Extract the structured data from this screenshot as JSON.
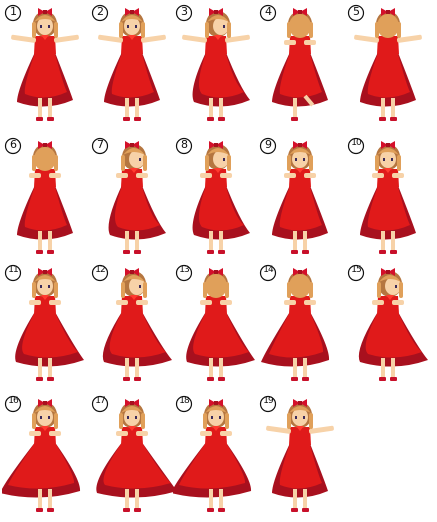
{
  "sheet": {
    "frames": [
      {
        "label": "1",
        "pose": "front-arms-out"
      },
      {
        "label": "2",
        "pose": "three-quarter-arms-out"
      },
      {
        "label": "3",
        "pose": "side-arms-out"
      },
      {
        "label": "4",
        "pose": "back-side-kick"
      },
      {
        "label": "5",
        "pose": "back-arms-out"
      },
      {
        "label": "6",
        "pose": "back-turn"
      },
      {
        "label": "7",
        "pose": "side-turn"
      },
      {
        "label": "8",
        "pose": "side-hands-in"
      },
      {
        "label": "9",
        "pose": "front-hands-in"
      },
      {
        "label": "10",
        "pose": "front-hands-in"
      },
      {
        "label": "11",
        "pose": "front-twirl"
      },
      {
        "label": "12",
        "pose": "side-twirl"
      },
      {
        "label": "13",
        "pose": "back-twirl"
      },
      {
        "label": "14",
        "pose": "back-twirl"
      },
      {
        "label": "15",
        "pose": "side-twirl"
      },
      {
        "label": "16",
        "pose": "front-skirt-swirl"
      },
      {
        "label": "17",
        "pose": "front-skirt-swirl"
      },
      {
        "label": "18",
        "pose": "front-skirt-swirl"
      },
      {
        "label": "19",
        "pose": "front-arms-open"
      }
    ]
  },
  "colors": {
    "dress": "#e01a1a",
    "dress_shadow": "#a8101e",
    "dress_highlight": "#ff3a2e",
    "hair": "#e0a05a",
    "hair_dark": "#b57640",
    "skin": "#f7d2a8",
    "bow": "#d4102a",
    "shoe": "#c8102a"
  }
}
